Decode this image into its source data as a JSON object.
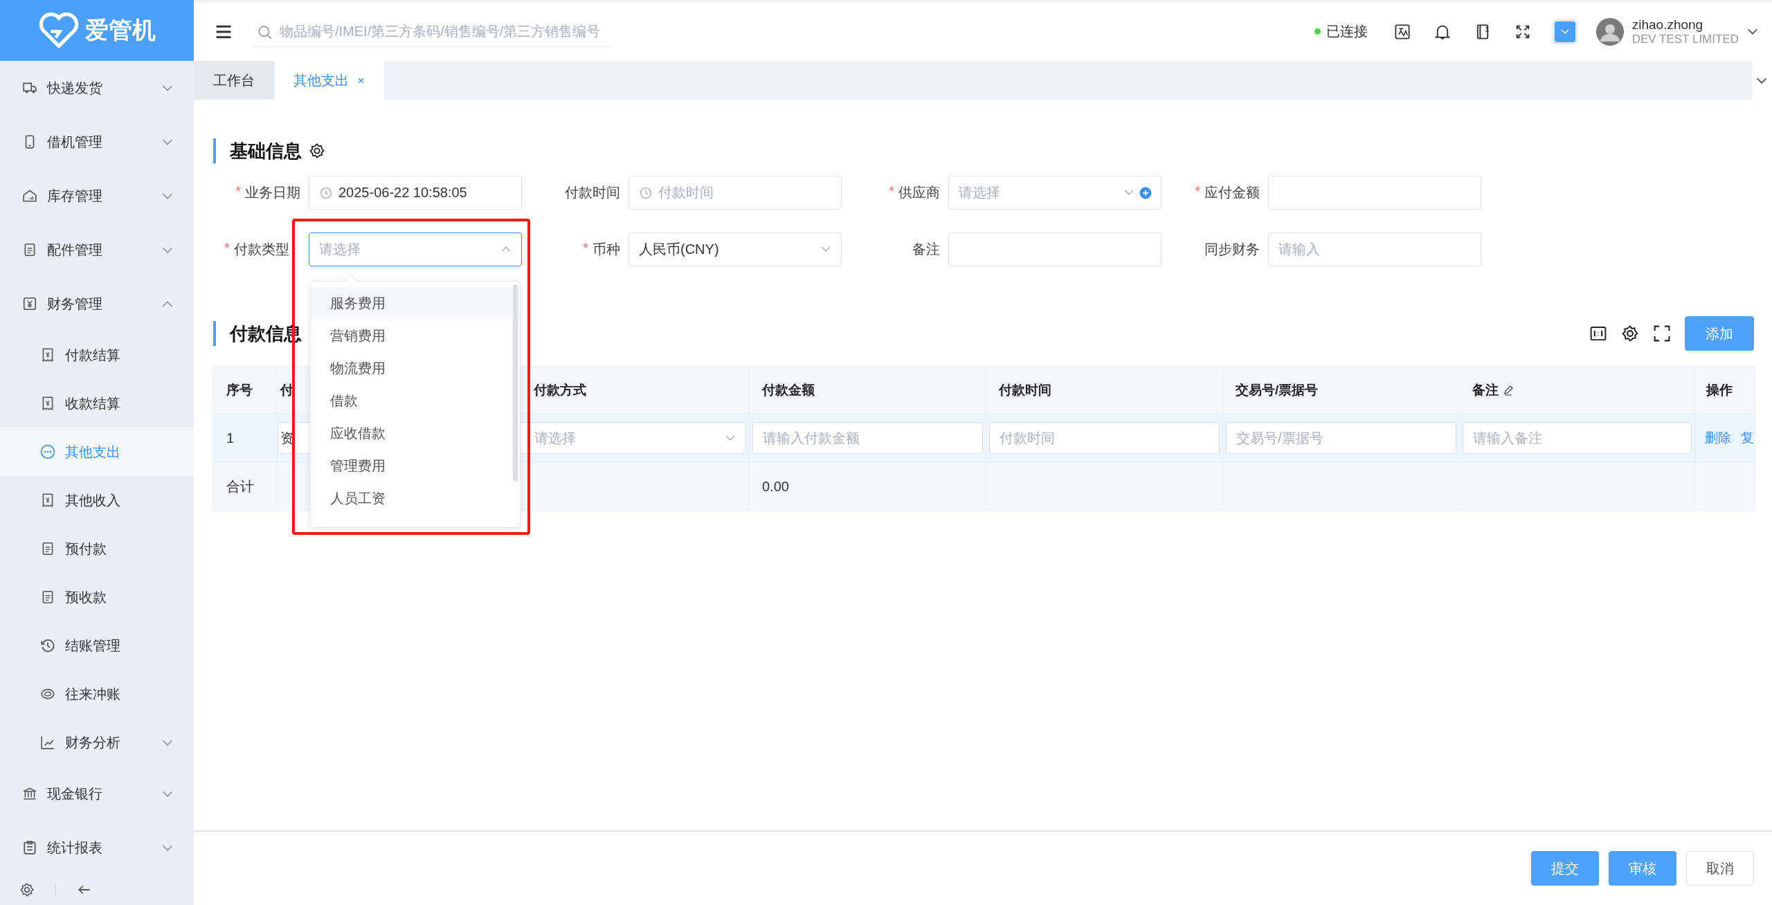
{
  "logo": {
    "text": "爱管机"
  },
  "topbar": {
    "search": {
      "placeholder": "物品编号/IMEI/第三方条码/销售编号/第三方销售编号"
    },
    "connection": {
      "label": "已连接",
      "color": "#52d14a"
    },
    "user": {
      "name": "zihao.zhong",
      "company": "DEV TEST LIMITED"
    }
  },
  "sidebar": {
    "items": [
      {
        "label": "快递发货",
        "selected": false,
        "expanded": false
      },
      {
        "label": "借机管理",
        "selected": false,
        "expanded": false
      },
      {
        "label": "库存管理",
        "selected": false,
        "expanded": false
      },
      {
        "label": "配件管理",
        "selected": false,
        "expanded": false
      },
      {
        "label": "财务管理",
        "selected": false,
        "expanded": true,
        "children": [
          {
            "label": "付款结算",
            "selected": false
          },
          {
            "label": "收款结算",
            "selected": false
          },
          {
            "label": "其他支出",
            "selected": true
          },
          {
            "label": "其他收入",
            "selected": false
          },
          {
            "label": "预付款",
            "selected": false
          },
          {
            "label": "预收款",
            "selected": false
          },
          {
            "label": "结账管理",
            "selected": false
          },
          {
            "label": "往来冲账",
            "selected": false
          },
          {
            "label": "财务分析",
            "selected": false,
            "expanded": false
          }
        ]
      },
      {
        "label": "现金银行",
        "selected": false,
        "expanded": false
      },
      {
        "label": "统计报表",
        "selected": false,
        "expanded": false
      }
    ]
  },
  "tabs": [
    {
      "label": "工作台",
      "selected": false,
      "closable": false
    },
    {
      "label": "其他支出",
      "selected": true,
      "closable": true
    }
  ],
  "basic_info": {
    "title": "基础信息",
    "fields": [
      {
        "label": "业务日期",
        "required_mark": "*",
        "kind": "date",
        "value": "2025-06-22 10:58:05"
      },
      {
        "label": "付款时间",
        "kind": "date",
        "placeholder": "付款时间"
      },
      {
        "label": "供应商",
        "required_mark": "*",
        "kind": "select_add",
        "placeholder": "请选择",
        "open": false
      },
      {
        "label": "应付金额",
        "required_mark": "*",
        "kind": "input"
      },
      {
        "label": "付款类型",
        "required_mark": "*",
        "kind": "select",
        "placeholder": "请选择",
        "open": true,
        "highlighted": true,
        "options": [
          {
            "label": "服务费用",
            "hovered": true
          },
          {
            "label": "营销费用",
            "hovered": false
          },
          {
            "label": "物流费用",
            "hovered": false
          },
          {
            "label": "借款",
            "hovered": false
          },
          {
            "label": "应收借款",
            "hovered": false
          },
          {
            "label": "管理费用",
            "hovered": false
          },
          {
            "label": "人员工资",
            "hovered": false
          }
        ]
      },
      {
        "label": "币种",
        "required_mark": "*",
        "kind": "select",
        "value": "人民币(CNY)",
        "open": false
      },
      {
        "label": "备注",
        "kind": "input"
      },
      {
        "label": "同步财务",
        "kind": "input",
        "placeholder": "请输入"
      }
    ]
  },
  "payment_info": {
    "title": "付款信息",
    "add_button": "添加",
    "columns": [
      {
        "label": "序号"
      },
      {
        "label": "付"
      },
      {
        "label": "付款方式"
      },
      {
        "label": "付款金额"
      },
      {
        "label": "付款时间"
      },
      {
        "label": "交易号/票据号"
      },
      {
        "label": "备注",
        "editable": true
      },
      {
        "label": "操作"
      }
    ],
    "rows": [
      {
        "cells": [
          {
            "kind": "text",
            "value": "1"
          },
          {
            "kind": "input",
            "value": "资"
          },
          {
            "kind": "select",
            "placeholder": "请选择"
          },
          {
            "kind": "input",
            "placeholder": "请输入付款金额"
          },
          {
            "kind": "input",
            "placeholder": "付款时间"
          },
          {
            "kind": "input",
            "placeholder": "交易号/票据号"
          },
          {
            "kind": "input",
            "placeholder": "请输入备注"
          },
          {
            "kind": "actions",
            "links": [
              "删除",
              "复"
            ]
          }
        ]
      }
    ],
    "total": {
      "label": "合计",
      "amount": "0.00"
    }
  },
  "footer": {
    "buttons": [
      {
        "label": "提交",
        "kind": "primary"
      },
      {
        "label": "审核",
        "kind": "primary"
      },
      {
        "label": "取消",
        "kind": "default"
      }
    ]
  }
}
